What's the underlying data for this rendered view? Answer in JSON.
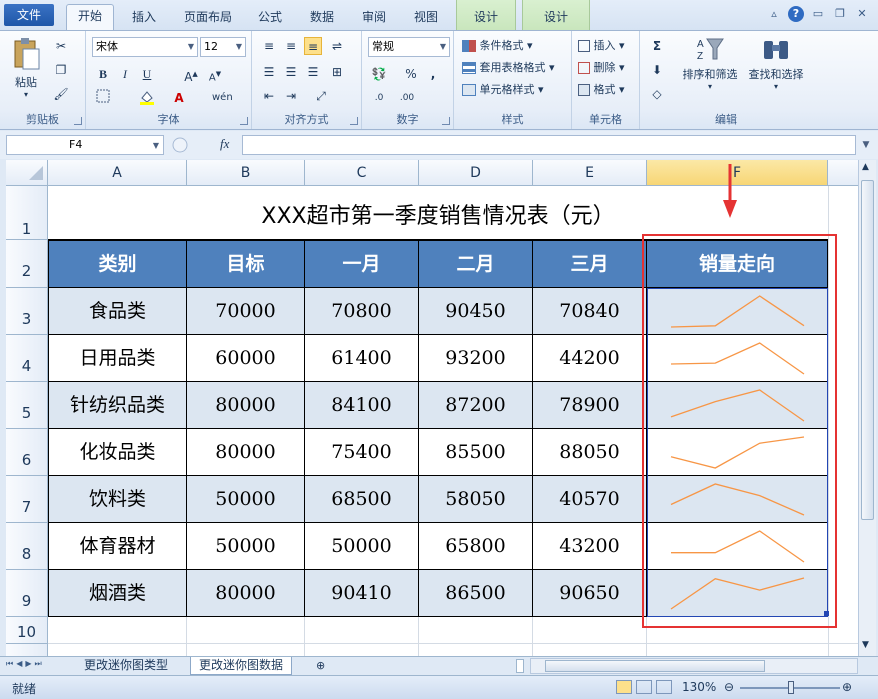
{
  "ribbon_tabs": {
    "file": "文件",
    "home": "开始",
    "insert": "插入",
    "page_layout": "页面布局",
    "formulas": "公式",
    "data": "数据",
    "review": "审阅",
    "view": "视图",
    "design1": "设计",
    "design2": "设计"
  },
  "window_buttons": {
    "minimize": "▭",
    "restore": "❐",
    "close": "✕",
    "help": "?"
  },
  "clipboard": {
    "paste": "粘贴",
    "group": "剪贴板"
  },
  "font": {
    "name": "宋体",
    "size": "12",
    "group": "字体"
  },
  "alignment": {
    "group": "对齐方式"
  },
  "number": {
    "format": "常规",
    "group": "数字"
  },
  "styles": {
    "conditional": "条件格式",
    "table": "套用表格格式",
    "cell": "单元格样式",
    "group": "样式"
  },
  "cells": {
    "insert": "插入",
    "delete": "删除",
    "format": "格式",
    "group": "单元格"
  },
  "editing": {
    "sort": "排序和筛选",
    "find": "查找和选择",
    "group": "编辑"
  },
  "formula_bar": {
    "name_box": "F4",
    "fx": "fx",
    "formula": ""
  },
  "columns": [
    "A",
    "B",
    "C",
    "D",
    "E",
    "F"
  ],
  "rows": [
    "1",
    "2",
    "3",
    "4",
    "5",
    "6",
    "7",
    "8",
    "9",
    "10"
  ],
  "sheet": {
    "title": "XXX超市第一季度销售情况表（元）",
    "headers": [
      "类别",
      "目标",
      "一月",
      "二月",
      "三月",
      "销量走向"
    ],
    "data": [
      [
        "食品类",
        "70000",
        "70800",
        "90450",
        "70840"
      ],
      [
        "日用品类",
        "60000",
        "61400",
        "93200",
        "44200"
      ],
      [
        "针纺织品类",
        "80000",
        "84100",
        "87200",
        "78900"
      ],
      [
        "化妆品类",
        "80000",
        "75400",
        "85500",
        "88050"
      ],
      [
        "饮料类",
        "50000",
        "68500",
        "58050",
        "40570"
      ],
      [
        "体育器材",
        "50000",
        "50000",
        "65800",
        "43200"
      ],
      [
        "烟酒类",
        "80000",
        "90410",
        "86500",
        "90650"
      ]
    ]
  },
  "colors": {
    "header_fill": "#4f81bd",
    "band_fill": "#dce6f1",
    "sparkline": "#f79646",
    "annotation": "#e53333"
  },
  "sheet_tabs": [
    "更改迷你图类型",
    "更改迷你图数据"
  ],
  "status": {
    "ready": "就绪",
    "zoom": "130%"
  }
}
